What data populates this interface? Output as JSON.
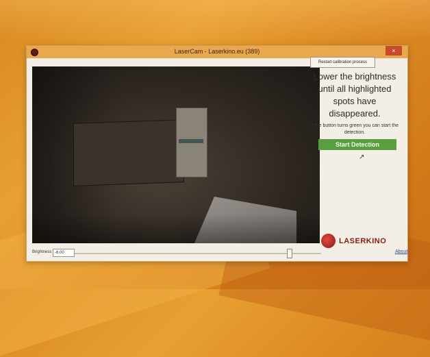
{
  "window": {
    "title": "LaserCam - Laserkino.eu (389)",
    "close_label": "×"
  },
  "panel": {
    "restart_label": "Restart calibration process",
    "instruction": "Lower the brightness until all highlighted spots have disappeared.",
    "hint": "If the button turns green you can start the detection.",
    "start_label": "Start Detection"
  },
  "bottom": {
    "brightness_label": "Brightness",
    "brightness_value": "-6.00",
    "about_label": "About"
  },
  "logo": {
    "text": "LASERKINO"
  },
  "colors": {
    "accent_green": "#5a9e40",
    "titlebar": "#e9a84e",
    "logo_red": "#8a1a12"
  }
}
